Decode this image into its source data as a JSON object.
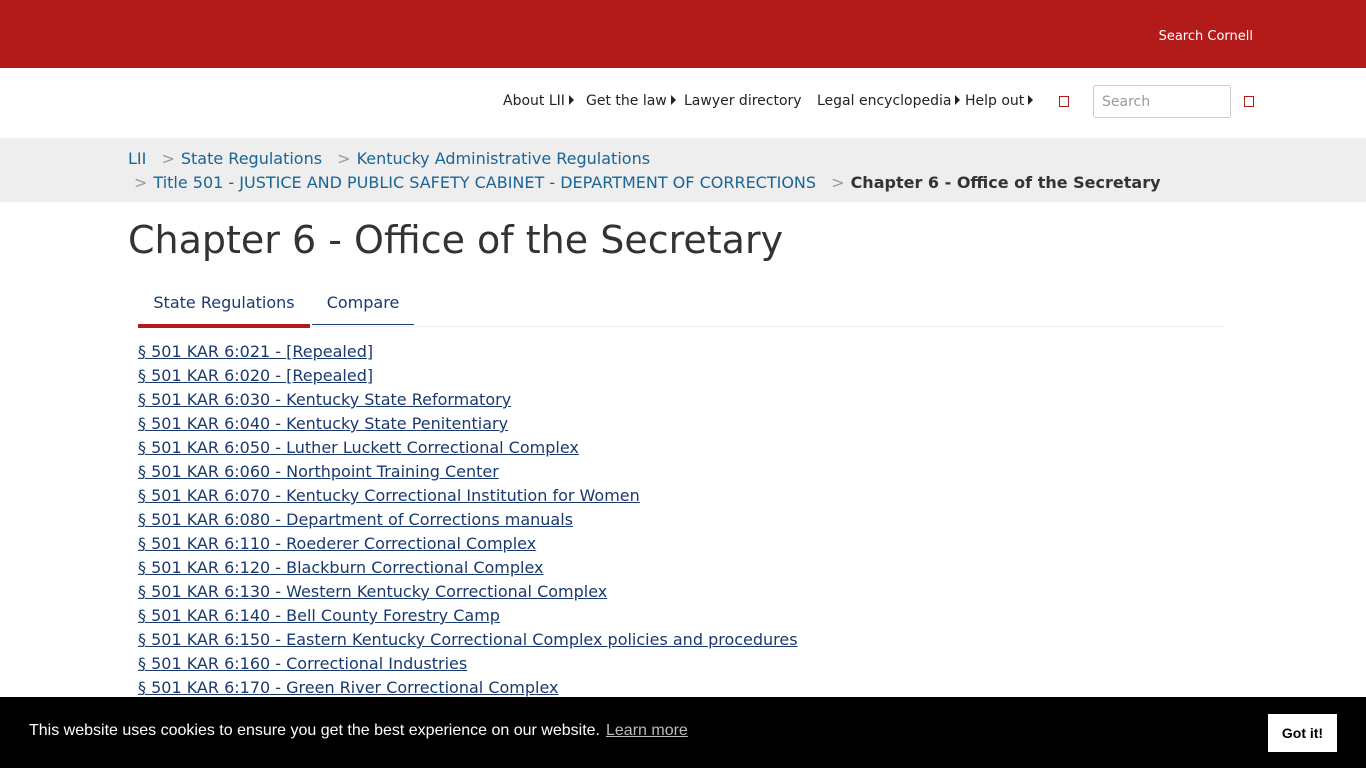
{
  "topbar": {
    "search_cornell": "Search Cornell"
  },
  "nav": {
    "items": [
      {
        "label": "About LII",
        "caret": true
      },
      {
        "label": "Get the law",
        "caret": true
      },
      {
        "label": "Lawyer directory",
        "caret": false
      },
      {
        "label": "Legal encyclopedia",
        "caret": true
      },
      {
        "label": "Help out",
        "caret": true
      }
    ],
    "search_placeholder": "Search",
    "accent_color": "#b31b1b"
  },
  "breadcrumb": {
    "lii": "LII",
    "state_regulations": "State Regulations",
    "kentucky": "Kentucky Administrative Regulations",
    "title": "Title 501 - JUSTICE AND PUBLIC SAFETY CABINET - DEPARTMENT OF CORRECTIONS",
    "current": "Chapter 6 - Office of the Secretary",
    "separator": ">"
  },
  "page": {
    "title": "Chapter 6 - Office of the Secretary"
  },
  "tabs": [
    {
      "label": "State Regulations",
      "active": true
    },
    {
      "label": "Compare",
      "active": false
    }
  ],
  "regulations": [
    "§ 501 KAR 6:021 - [Repealed]",
    "§ 501 KAR 6:020 - [Repealed]",
    "§ 501 KAR 6:030 - Kentucky State Reformatory",
    "§ 501 KAR 6:040 - Kentucky State Penitentiary",
    "§ 501 KAR 6:050 - Luther Luckett Correctional Complex",
    "§ 501 KAR 6:060 - Northpoint Training Center",
    "§ 501 KAR 6:070 - Kentucky Correctional Institution for Women",
    "§ 501 KAR 6:080 - Department of Corrections manuals",
    "§ 501 KAR 6:110 - Roederer Correctional Complex",
    "§ 501 KAR 6:120 - Blackburn Correctional Complex",
    "§ 501 KAR 6:130 - Western Kentucky Correctional Complex",
    "§ 501 KAR 6:140 - Bell County Forestry Camp",
    "§ 501 KAR 6:150 - Eastern Kentucky Correctional Complex policies and procedures",
    "§ 501 KAR 6:160 - Correctional Industries",
    "§ 501 KAR 6:170 - Green River Correctional Complex"
  ],
  "cookie": {
    "message": "This website uses cookies to ensure you get the best experience on our website.",
    "learn_more": "Learn more",
    "got_it": "Got it!"
  }
}
